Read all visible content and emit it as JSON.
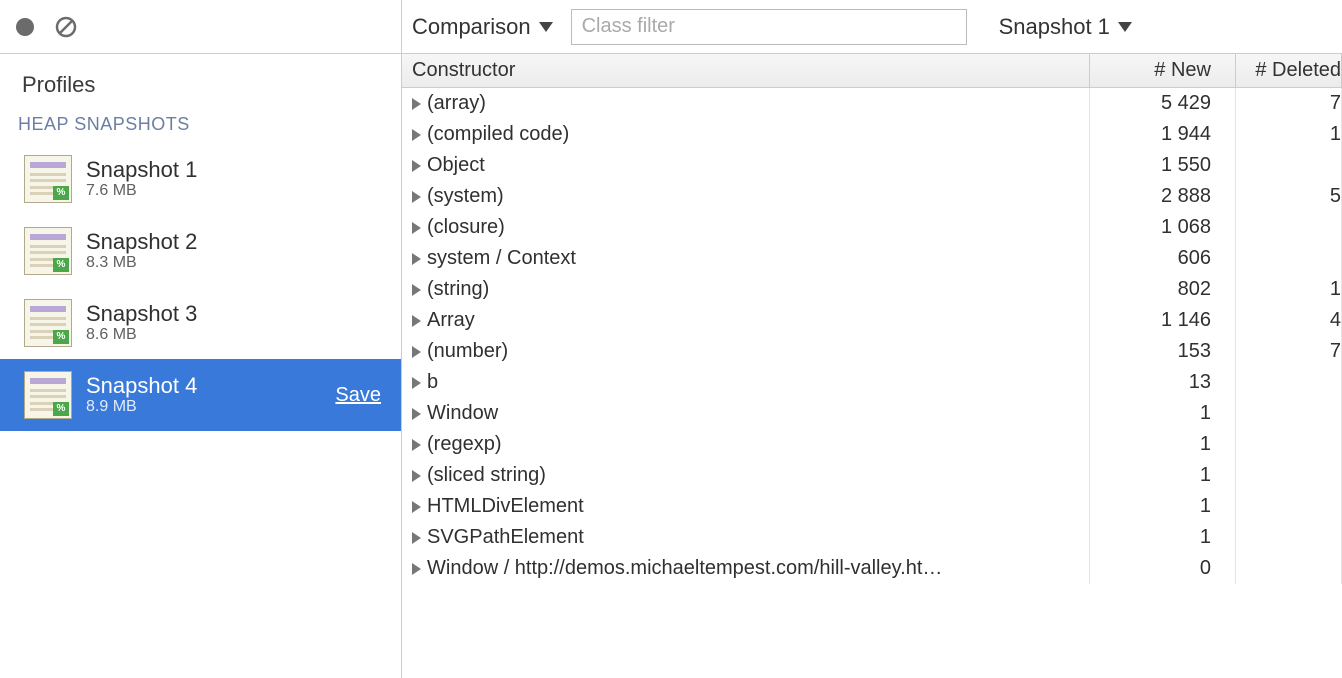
{
  "sidebar": {
    "title": "Profiles",
    "section": "HEAP SNAPSHOTS",
    "snapshots": [
      {
        "name": "Snapshot 1",
        "size": "7.6 MB"
      },
      {
        "name": "Snapshot 2",
        "size": "8.3 MB"
      },
      {
        "name": "Snapshot 3",
        "size": "8.6 MB"
      },
      {
        "name": "Snapshot 4",
        "size": "8.9 MB"
      }
    ],
    "save_label": "Save",
    "selected_index": 3
  },
  "toolbar": {
    "view_mode": "Comparison",
    "filter_placeholder": "Class filter",
    "baseline": "Snapshot 1"
  },
  "table": {
    "columns": {
      "constructor": "Constructor",
      "new": "# New",
      "deleted": "# Deleted"
    },
    "rows": [
      {
        "c": "(array)",
        "n": "5 429",
        "d": "7"
      },
      {
        "c": "(compiled code)",
        "n": "1 944",
        "d": "1"
      },
      {
        "c": "Object",
        "n": "1 550",
        "d": ""
      },
      {
        "c": "(system)",
        "n": "2 888",
        "d": "5"
      },
      {
        "c": "(closure)",
        "n": "1 068",
        "d": ""
      },
      {
        "c": "system / Context",
        "n": "606",
        "d": ""
      },
      {
        "c": "(string)",
        "n": "802",
        "d": "1"
      },
      {
        "c": "Array",
        "n": "1 146",
        "d": "4"
      },
      {
        "c": "(number)",
        "n": "153",
        "d": "7"
      },
      {
        "c": "b",
        "n": "13",
        "d": ""
      },
      {
        "c": "Window",
        "n": "1",
        "d": ""
      },
      {
        "c": "(regexp)",
        "n": "1",
        "d": ""
      },
      {
        "c": "(sliced string)",
        "n": "1",
        "d": ""
      },
      {
        "c": "HTMLDivElement",
        "n": "1",
        "d": ""
      },
      {
        "c": "SVGPathElement",
        "n": "1",
        "d": ""
      },
      {
        "c": "Window / http://demos.michaeltempest.com/hill-valley.ht…",
        "n": "0",
        "d": ""
      }
    ]
  }
}
